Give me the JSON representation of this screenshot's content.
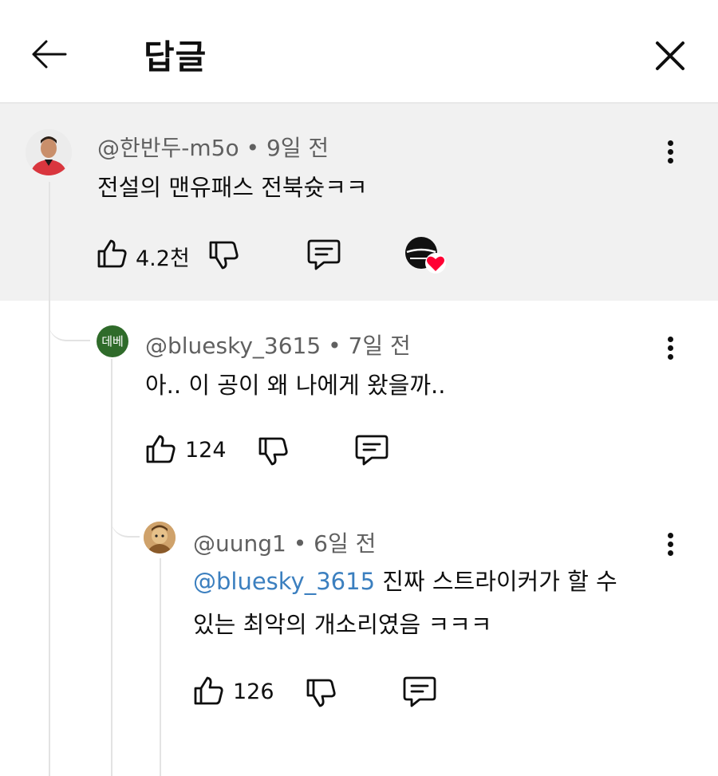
{
  "header": {
    "title": "답글",
    "back_icon": "arrow-left-icon",
    "close_icon": "close-icon"
  },
  "comments": [
    {
      "handle": "@한반두-m5o",
      "time": "9일 전",
      "text": "전설의 맨유패스 전북슛ㅋㅋ",
      "likes": "4.2천",
      "creator_heart": true
    },
    {
      "handle": "@bluesky_3615",
      "time": "7일 전",
      "avatar_text": "데베",
      "text": "아.. 이 공이 왜 나에게 왔을까..",
      "likes": "124"
    },
    {
      "handle": "@uung1",
      "time": "6일 전",
      "mention": "@bluesky_3615",
      "text_line1": "진짜 스트라이커가 할 수",
      "text_line2": "있는 최악의 개소리였음 ㅋㅋㅋ",
      "likes": "126"
    }
  ],
  "separator": "•",
  "colors": {
    "highlight_bg": "#f1f1f1",
    "mention": "#3b7fbf",
    "meta_gray": "#606060",
    "avatar_green": "#2f6b2a",
    "heart_red": "#ff0033"
  }
}
